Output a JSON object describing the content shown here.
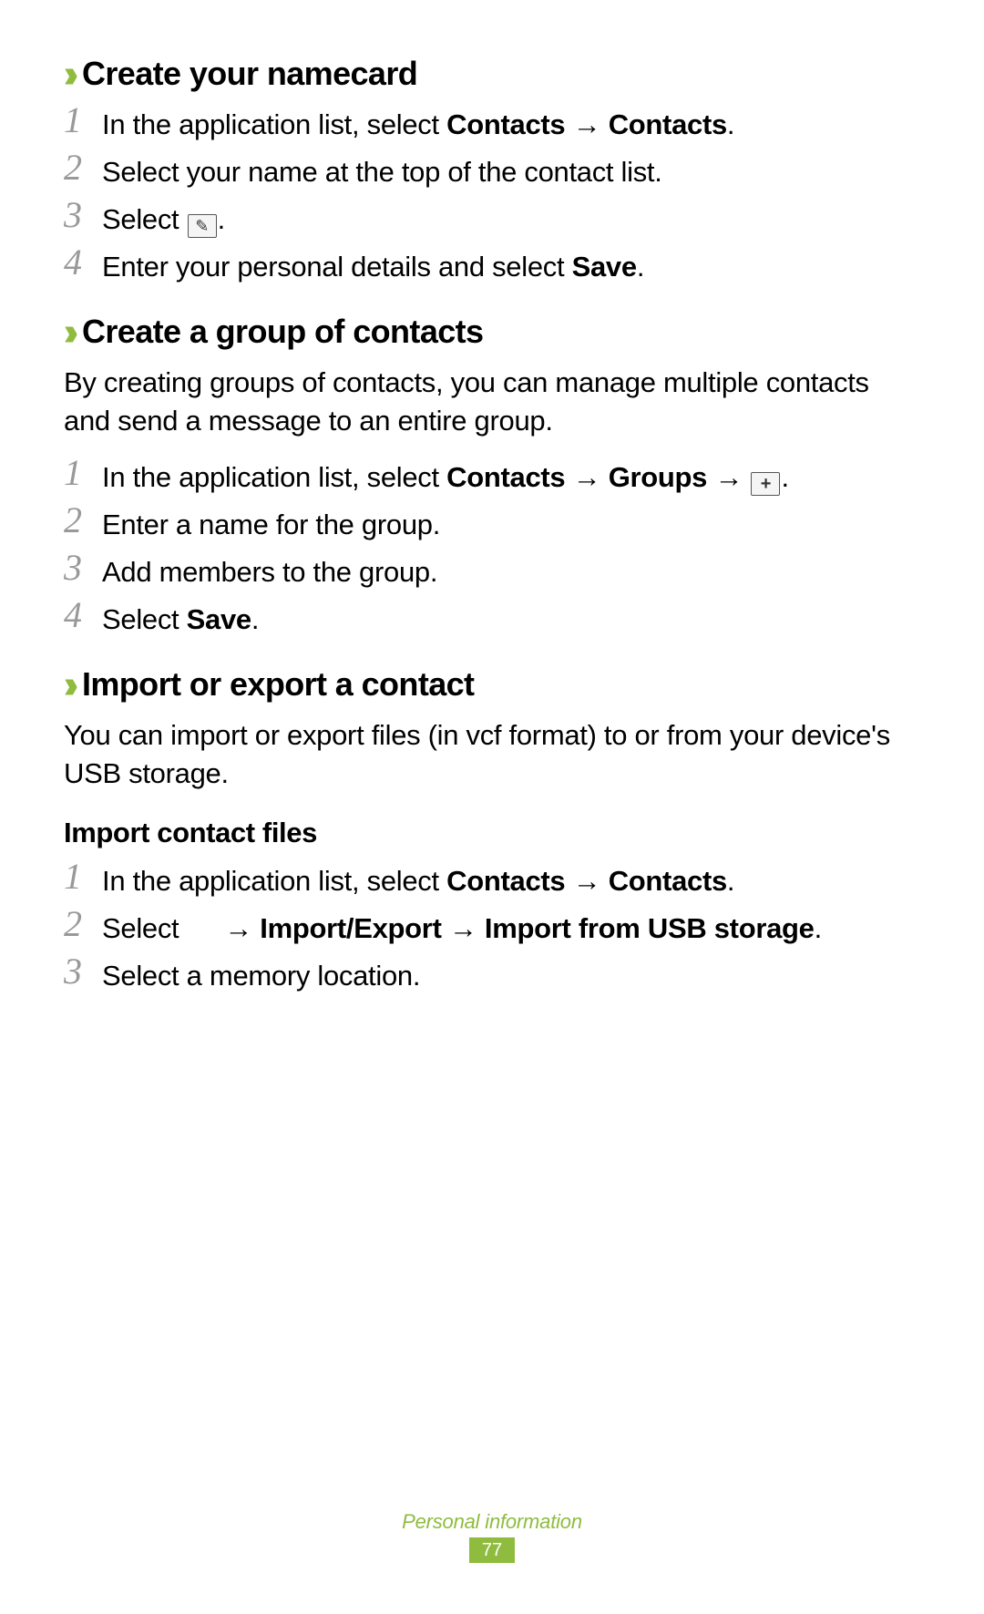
{
  "sections": [
    {
      "title": "Create your namecard",
      "steps": [
        {
          "num": "1",
          "prefix": "In the application list, select ",
          "bold1": "Contacts",
          "arrow1": " → ",
          "bold2": "Contacts",
          "suffix": "."
        },
        {
          "num": "2",
          "plain": "Select your name at the top of the contact list."
        },
        {
          "num": "3",
          "prefix": "Select ",
          "icon": "edit",
          "suffix": "."
        },
        {
          "num": "4",
          "prefix": "Enter your personal details and select ",
          "bold1": "Save",
          "suffix": "."
        }
      ]
    },
    {
      "title": "Create a group of contacts",
      "desc": "By creating groups of contacts, you can manage multiple contacts and send a message to an entire group.",
      "steps": [
        {
          "num": "1",
          "prefix": "In the application list, select ",
          "bold1": "Contacts",
          "arrow1": " → ",
          "bold2": "Groups",
          "arrow2": " → ",
          "icon": "plus",
          "suffix": "."
        },
        {
          "num": "2",
          "plain": "Enter a name for the group."
        },
        {
          "num": "3",
          "plain": "Add members to the group."
        },
        {
          "num": "4",
          "prefix": "Select ",
          "bold1": "Save",
          "suffix": "."
        }
      ]
    },
    {
      "title": "Import or export a contact",
      "desc": "You can import or export files (in vcf format) to or from your device's USB storage.",
      "subheading": "Import contact files",
      "steps": [
        {
          "num": "1",
          "prefix": "In the application list, select ",
          "bold1": "Contacts",
          "arrow1": " → ",
          "bold2": "Contacts",
          "suffix": "."
        },
        {
          "num": "2",
          "prefix": "Select ",
          "gap": true,
          "arrow1": "→ ",
          "bold1": "Import/Export",
          "arrow2": " → ",
          "bold2": "Import from USB storage",
          "suffix": "."
        },
        {
          "num": "3",
          "plain": "Select a memory location."
        }
      ]
    }
  ],
  "footer": {
    "category": "Personal information",
    "page": "77"
  }
}
